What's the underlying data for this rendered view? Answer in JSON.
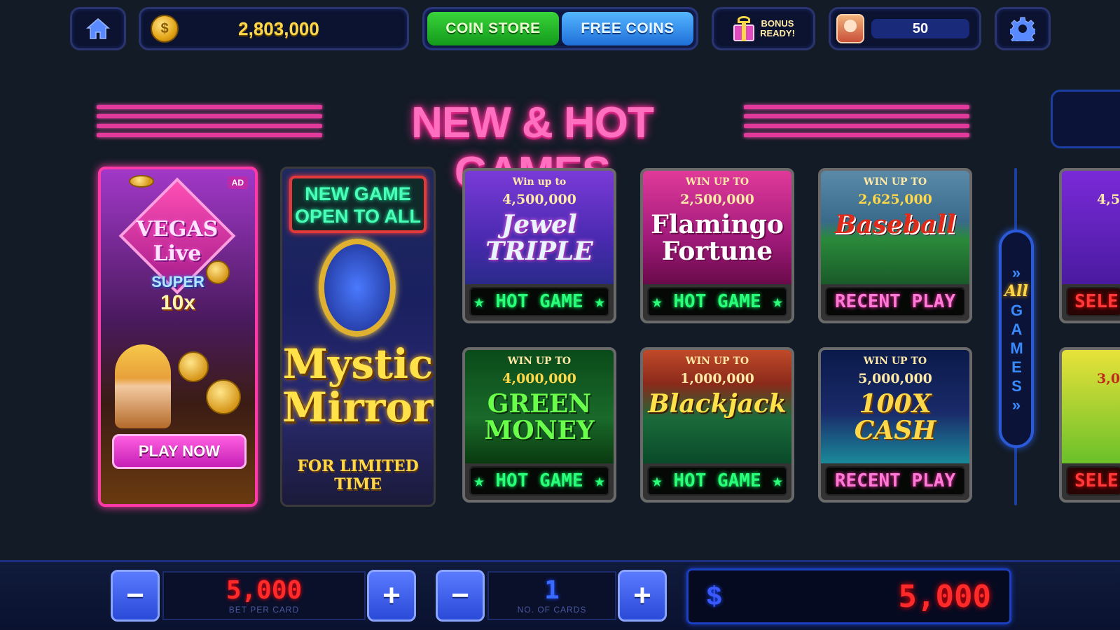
{
  "topbar": {
    "coin_balance": "2,803,000",
    "coin_store_label": "COIN STORE",
    "free_coins_label": "FREE COINS",
    "bonus_label_line1": "BONUS",
    "bonus_label_line2": "READY!",
    "level_value": "50"
  },
  "heading": {
    "title": "NEW & HOT GAMES"
  },
  "ad_card": {
    "badge": "AD",
    "logo_text": "VEGAS Live",
    "super_text": "SUPER",
    "multiplier": "10x",
    "play_label": "PLAY NOW"
  },
  "mystic_card": {
    "banner": "NEW GAME OPEN TO ALL",
    "title": "Mystic Mirror",
    "footer": "FOR LIMITED TIME"
  },
  "games": [
    {
      "win_text": "Win up to",
      "win_amount": "4,500,000",
      "title": "Jewel TRIPLE",
      "label": "★ HOT GAME ★",
      "label_type": "hot"
    },
    {
      "win_text": "WIN UP TO",
      "win_amount": "2,500,000",
      "title": "Flamingo Fortune",
      "label": "★ HOT GAME ★",
      "label_type": "hot"
    },
    {
      "win_text": "WIN UP TO",
      "win_amount": "2,625,000",
      "title": "Baseball",
      "label": "RECENT PLAY",
      "label_type": "recent"
    },
    {
      "win_text": "WIN UP TO",
      "win_amount": "4,000,000",
      "title": "GREEN MONEY",
      "label": "★ HOT GAME ★",
      "label_type": "hot"
    },
    {
      "win_text": "WIN UP TO",
      "win_amount": "1,000,000",
      "title": "Blackjack",
      "label": "★ HOT GAME ★",
      "label_type": "hot"
    },
    {
      "win_text": "WIN UP TO",
      "win_amount": "5,000,000",
      "title": "100X CASH",
      "label": "RECENT PLAY",
      "label_type": "recent"
    }
  ],
  "partial_games": [
    {
      "win_amount": "4,5",
      "label": "SELE"
    },
    {
      "win_amount": "3,0",
      "label": "SELE"
    }
  ],
  "all_games": {
    "top": "All",
    "letters": "GAMES"
  },
  "bottom": {
    "bet_value": "5,000",
    "bet_caption": "BET PER CARD",
    "cards_value": "1",
    "cards_caption": "NO. OF CARDS",
    "total_currency": "$",
    "total_value": "5,000",
    "minus": "−",
    "plus": "+"
  }
}
